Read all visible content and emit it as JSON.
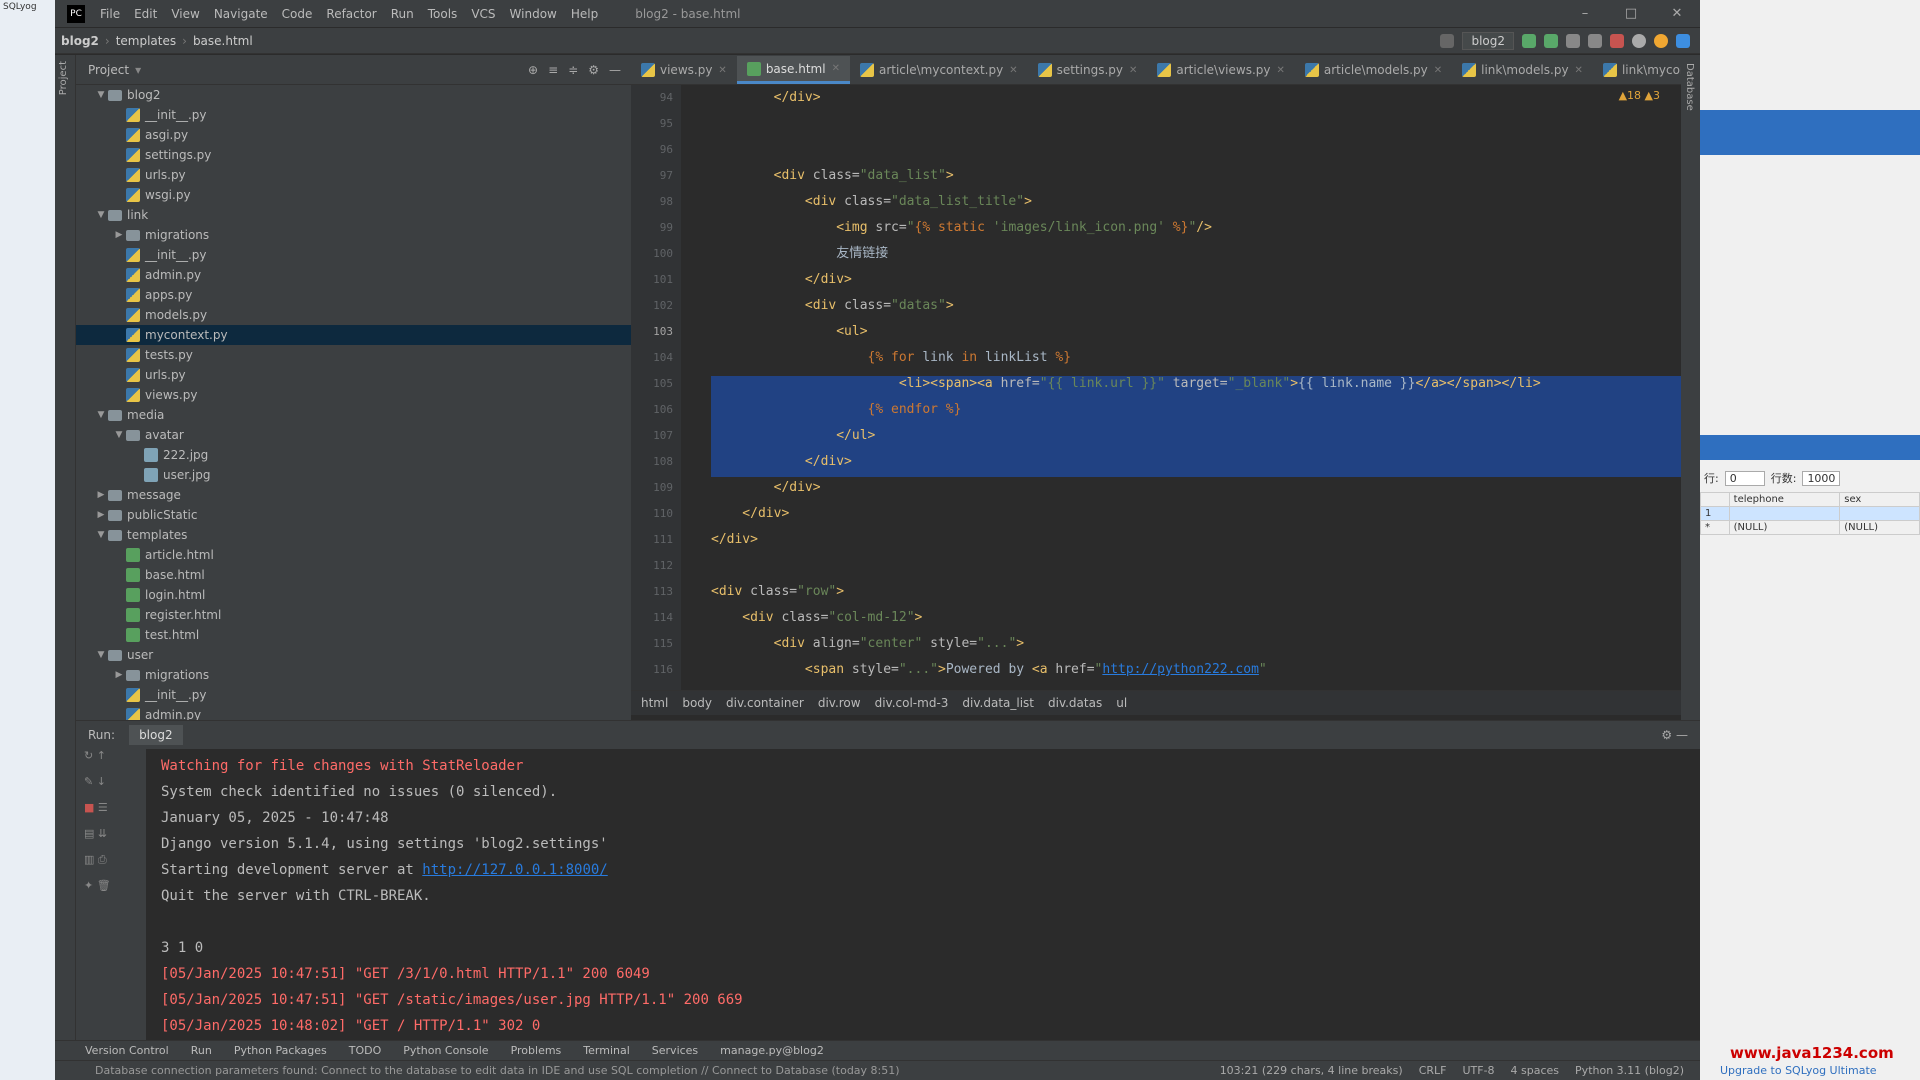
{
  "menubar": {
    "items": [
      "File",
      "Edit",
      "View",
      "Navigate",
      "Code",
      "Refactor",
      "Run",
      "Tools",
      "VCS",
      "Window",
      "Help"
    ],
    "title": "blog2 - base.html"
  },
  "navbar": {
    "crumbs": [
      "blog2",
      "templates",
      "base.html"
    ],
    "run_config": "blog2"
  },
  "project": {
    "header": "Project",
    "tree": [
      {
        "label": "blog2",
        "type": "folder",
        "depth": 1,
        "open": true
      },
      {
        "label": "__init__.py",
        "type": "py",
        "depth": 2
      },
      {
        "label": "asgi.py",
        "type": "py",
        "depth": 2
      },
      {
        "label": "settings.py",
        "type": "py",
        "depth": 2
      },
      {
        "label": "urls.py",
        "type": "py",
        "depth": 2
      },
      {
        "label": "wsgi.py",
        "type": "py",
        "depth": 2
      },
      {
        "label": "link",
        "type": "folder",
        "depth": 1,
        "open": true
      },
      {
        "label": "migrations",
        "type": "folder",
        "depth": 2,
        "open": false
      },
      {
        "label": "__init__.py",
        "type": "py",
        "depth": 2
      },
      {
        "label": "admin.py",
        "type": "py",
        "depth": 2
      },
      {
        "label": "apps.py",
        "type": "py",
        "depth": 2
      },
      {
        "label": "models.py",
        "type": "py",
        "depth": 2
      },
      {
        "label": "mycontext.py",
        "type": "py",
        "depth": 2,
        "selected": true
      },
      {
        "label": "tests.py",
        "type": "py",
        "depth": 2
      },
      {
        "label": "urls.py",
        "type": "py",
        "depth": 2
      },
      {
        "label": "views.py",
        "type": "py",
        "depth": 2
      },
      {
        "label": "media",
        "type": "folder",
        "depth": 1,
        "open": true
      },
      {
        "label": "avatar",
        "type": "folder",
        "depth": 2,
        "open": true
      },
      {
        "label": "222.jpg",
        "type": "img",
        "depth": 3
      },
      {
        "label": "user.jpg",
        "type": "img",
        "depth": 3
      },
      {
        "label": "message",
        "type": "folder",
        "depth": 1,
        "open": false
      },
      {
        "label": "publicStatic",
        "type": "folder",
        "depth": 1,
        "open": false
      },
      {
        "label": "templates",
        "type": "folder",
        "depth": 1,
        "open": true
      },
      {
        "label": "article.html",
        "type": "html",
        "depth": 2
      },
      {
        "label": "base.html",
        "type": "html",
        "depth": 2
      },
      {
        "label": "login.html",
        "type": "html",
        "depth": 2
      },
      {
        "label": "register.html",
        "type": "html",
        "depth": 2
      },
      {
        "label": "test.html",
        "type": "html",
        "depth": 2
      },
      {
        "label": "user",
        "type": "folder",
        "depth": 1,
        "open": true
      },
      {
        "label": "migrations",
        "type": "folder",
        "depth": 2,
        "open": false
      },
      {
        "label": "__init__.py",
        "type": "py",
        "depth": 2
      },
      {
        "label": "admin.py",
        "type": "py",
        "depth": 2
      }
    ]
  },
  "editor": {
    "tabs": [
      {
        "label": "views.py",
        "active": false
      },
      {
        "label": "base.html",
        "active": true
      },
      {
        "label": "article\\mycontext.py",
        "active": false
      },
      {
        "label": "settings.py",
        "active": false
      },
      {
        "label": "article\\views.py",
        "active": false
      },
      {
        "label": "article\\models.py",
        "active": false
      },
      {
        "label": "link\\models.py",
        "active": false
      },
      {
        "label": "link\\mycontext.py",
        "active": false
      }
    ],
    "inspections": "▲18 ▲3",
    "line_numbers": [
      "94",
      "95",
      "96",
      "97",
      "98",
      "99",
      "100",
      "101",
      "102",
      "103",
      "104",
      "105",
      "106",
      "107",
      "108",
      "109",
      "110",
      "111",
      "112",
      "113",
      "114",
      "115",
      "116"
    ],
    "breadcrumb": [
      "html",
      "body",
      "div.container",
      "div.row",
      "div.col-md-3",
      "div.data_list",
      "div.datas",
      "ul"
    ]
  },
  "run": {
    "label": "Run:",
    "tab": "blog2",
    "output": [
      {
        "text": "Watching for file changes with StatReloader",
        "cls": "red"
      },
      {
        "text": "System check identified no issues (0 silenced).",
        "cls": "norm"
      },
      {
        "text": "January 05, 2025 - 10:47:48",
        "cls": "norm"
      },
      {
        "text": "Django version 5.1.4, using settings 'blog2.settings'",
        "cls": "norm"
      },
      {
        "text": "Starting development server at ",
        "cls": "norm",
        "link": "http://127.0.0.1:8000/"
      },
      {
        "text": "Quit the server with CTRL-BREAK.",
        "cls": "norm"
      },
      {
        "text": "",
        "cls": "norm"
      },
      {
        "text": "3 1 0",
        "cls": "norm"
      },
      {
        "text": "[05/Jan/2025 10:47:51] \"GET /3/1/0.html HTTP/1.1\" 200 6049",
        "cls": "red"
      },
      {
        "text": "[05/Jan/2025 10:47:51] \"GET /static/images/user.jpg HTTP/1.1\" 200 669",
        "cls": "red"
      },
      {
        "text": "[05/Jan/2025 10:48:02] \"GET / HTTP/1.1\" 302 0",
        "cls": "red"
      }
    ]
  },
  "bottom_tabs": [
    "Version Control",
    "Run",
    "Python Packages",
    "TODO",
    "Python Console",
    "Problems",
    "Terminal",
    "Services",
    "manage.py@blog2"
  ],
  "status": {
    "message": "Database connection parameters found: Connect to the database to edit data in IDE and use SQL completion // Connect to Database (today 8:51)",
    "position": "103:21 (229 chars, 4 line breaks)",
    "line_sep": "CRLF",
    "encoding": "UTF-8",
    "indent": "4 spaces",
    "interpreter": "Python 3.11 (blog2)"
  },
  "sqlyog": {
    "offset_label": "行:",
    "offset_value": "0",
    "rows_label": "行数:",
    "rows_value": "1000",
    "columns": [
      "telephone",
      "sex"
    ],
    "rows": [
      [
        "(NULL)",
        "(NULL)"
      ]
    ],
    "footer": "Upgrade to SQLyog Ultimate",
    "watermark": "www.java1234.com"
  },
  "colors": {
    "selection": "#214283",
    "accent": "#4a88c7",
    "error": "#ff6b68"
  }
}
